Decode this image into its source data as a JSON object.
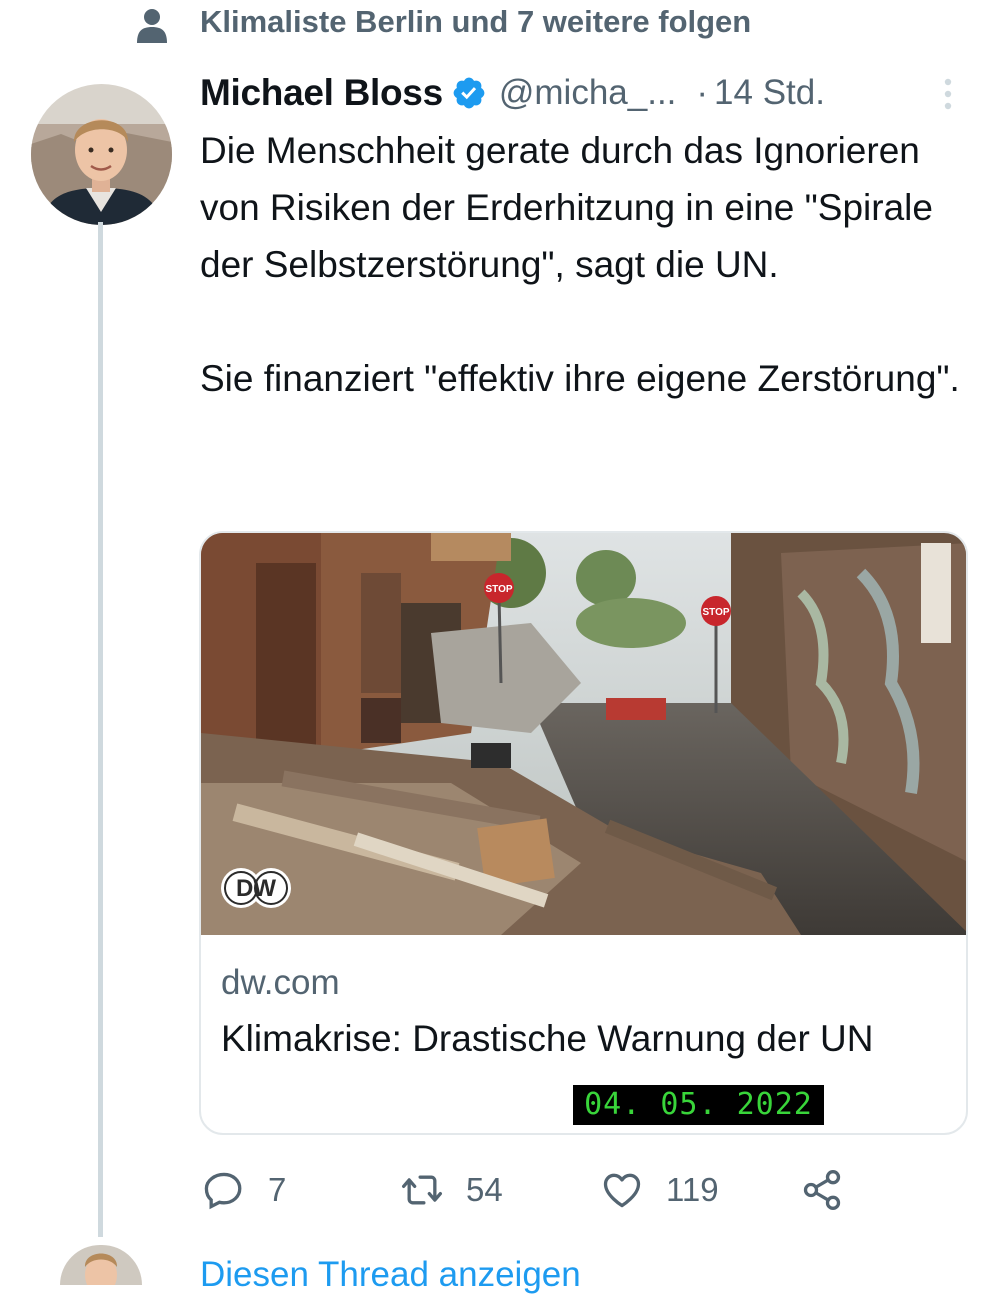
{
  "social_context": {
    "text": "Klimaliste Berlin und 7 weitere folgen"
  },
  "tweet": {
    "author_name": "Michael Bloss",
    "handle": "@micha_...",
    "separator": "·",
    "time": "14 Std.",
    "paragraphs": [
      "Die Menschheit gerate durch das Ignorieren von Risiken der Erderhitzung in eine \"Spirale der Selbstzerstörung\", sagt die UN.",
      "Sie finanziert \"effektiv ihre eigene Zerstörung\"."
    ],
    "card": {
      "domain": "dw.com",
      "title": "Klimakrise: Drastische Warnung der UN",
      "logo_text": "DW",
      "image_sign_text": "STOP"
    },
    "actions": {
      "replies": "7",
      "retweets": "54",
      "likes": "119"
    }
  },
  "overlay": {
    "date_stamp": "04. 05. 2022"
  },
  "next": {
    "link_text": "Diesen Thread anzeigen"
  },
  "colors": {
    "text": "#0f1419",
    "secondary": "#536471",
    "accent": "#1d9bf0",
    "thread_line": "#cfd9de",
    "stamp_bg": "#000000",
    "stamp_text": "#39d53a"
  },
  "icons": [
    "person-icon",
    "verified-badge-icon",
    "more-icon",
    "reply-icon",
    "retweet-icon",
    "like-icon",
    "share-icon"
  ]
}
